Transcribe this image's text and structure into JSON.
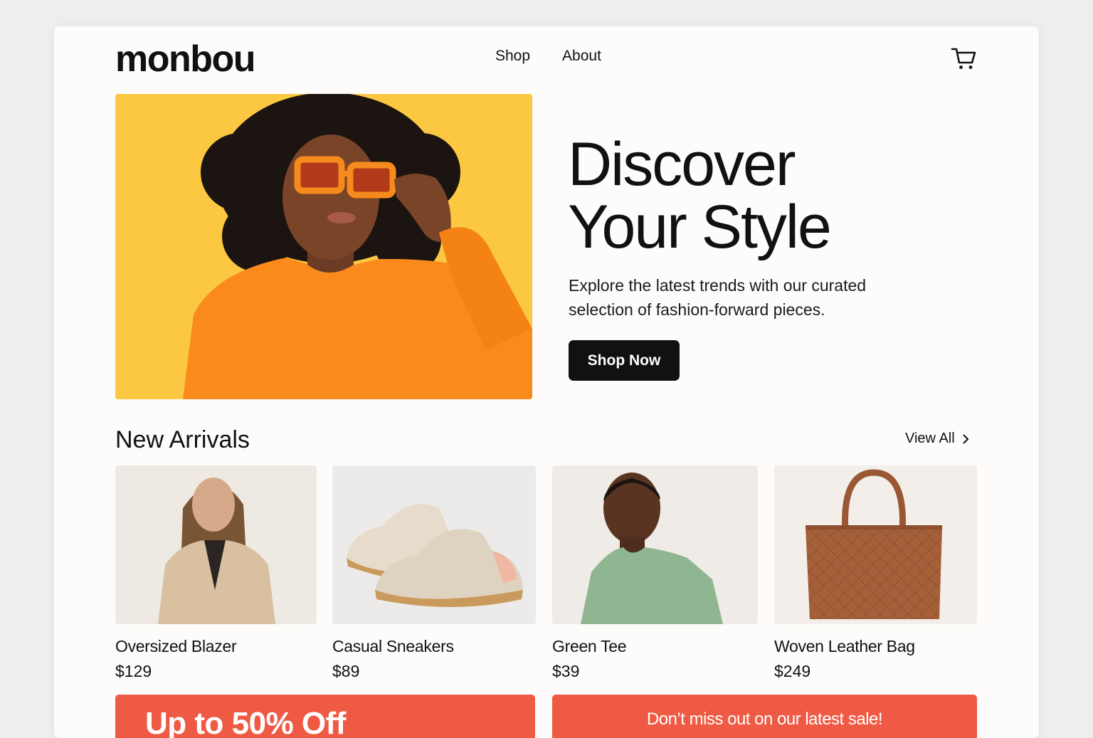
{
  "header": {
    "logo": "monbou",
    "nav": [
      "Shop",
      "About"
    ],
    "cart_icon": "cart-icon"
  },
  "hero": {
    "title_line1": "Discover",
    "title_line2": "Your Style",
    "subtitle": "Explore the latest trends with our curated selection of fashion-forward pieces.",
    "button": "Shop Now",
    "image": "woman-orange-sunglasses-photo"
  },
  "new_arrivals": {
    "title": "New Arrivals",
    "view_all": "View All",
    "products": [
      {
        "name": "Oversized Blazer",
        "price": "$129",
        "image": "blazer-photo"
      },
      {
        "name": "Casual Sneakers",
        "price": "$89",
        "image": "sneakers-photo"
      },
      {
        "name": "Green Tee",
        "price": "$39",
        "image": "green-tee-photo"
      },
      {
        "name": "Woven Leather Bag",
        "price": "$249",
        "image": "leather-bag-photo"
      }
    ]
  },
  "promos": {
    "left": "Up to 50% Off",
    "right": "Don’t miss out on our latest sale!"
  },
  "colors": {
    "background": "#efeeec",
    "card": "#fdfcfa",
    "hero_yellow": "#fcc842",
    "sweater_orange": "#fa8a1c",
    "button": "#111111",
    "promo_red": "#ef5a44"
  }
}
